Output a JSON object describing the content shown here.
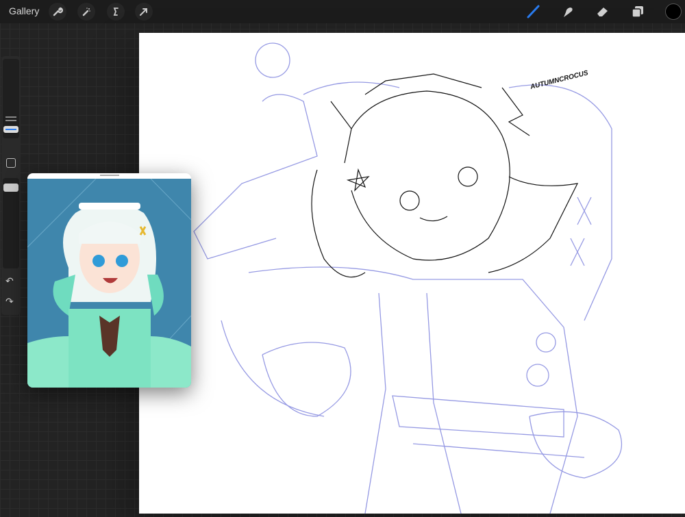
{
  "toolbar": {
    "gallery_label": "Gallery",
    "left_tools": [
      "wrench-icon",
      "magic-wand-icon",
      "selection-s-icon",
      "transform-arrow-icon"
    ],
    "right_tools": [
      "brush-icon",
      "smudge-icon",
      "eraser-icon",
      "layers-icon"
    ],
    "active_tool": "brush",
    "accent_color": "#2a7cf0",
    "current_color": "#000000"
  },
  "sidebar": {
    "brush_size_level": 0.78,
    "opacity_level": 0.2,
    "undo": "undo-icon",
    "redo": "redo-icon"
  },
  "canvas": {
    "signature": "AUTUMNCROCUS",
    "sketch_color": "#8a8ee0",
    "lineart_color": "#111111"
  },
  "reference": {
    "background_color": "#3f86ac"
  }
}
